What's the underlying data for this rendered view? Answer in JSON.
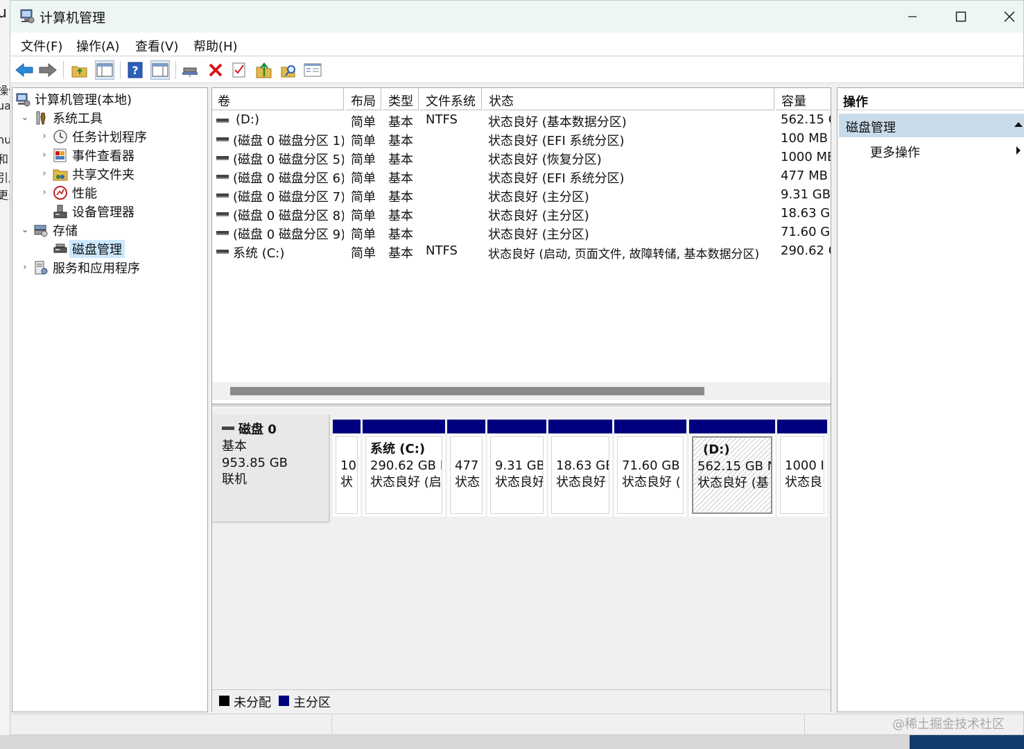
{
  "background": {
    "left_fragments": [
      "u",
      "操作",
      "ua",
      "hu",
      "和",
      "引用",
      "更多"
    ]
  },
  "window": {
    "title": "计算机管理"
  },
  "menubar": {
    "items": [
      "文件(F)",
      "操作(A)",
      "查看(V)",
      "帮助(H)"
    ]
  },
  "toolbar": {
    "icons": [
      "back-arrow-icon",
      "forward-arrow-icon",
      "up-folder-icon",
      "show-hide-console-tree-icon",
      "help-icon",
      "show-hide-action-pane-icon",
      "connect-icon",
      "delete-icon",
      "check-properties-icon",
      "export-icon",
      "search-icon",
      "properties-list-icon"
    ]
  },
  "tree": {
    "root": "计算机管理(本地)",
    "system_tools": "系统工具",
    "task_scheduler": "任务计划程序",
    "event_viewer": "事件查看器",
    "shared_folders": "共享文件夹",
    "performance": "性能",
    "device_manager": "设备管理器",
    "storage": "存储",
    "disk_management": "磁盘管理",
    "services_apps": "服务和应用程序"
  },
  "volume_list": {
    "columns": [
      "卷",
      "布局",
      "类型",
      "文件系统",
      "状态",
      "容量"
    ],
    "rows": [
      {
        "volume": "(D:)",
        "layout": "简单",
        "type": "基本",
        "fs": "NTFS",
        "status": "状态良好 (基本数据分区)",
        "capacity": "562.15 G"
      },
      {
        "volume": "(磁盘 0 磁盘分区 1)",
        "layout": "简单",
        "type": "基本",
        "fs": "",
        "status": "状态良好 (EFI 系统分区)",
        "capacity": "100 MB"
      },
      {
        "volume": "(磁盘 0 磁盘分区 5)",
        "layout": "简单",
        "type": "基本",
        "fs": "",
        "status": "状态良好 (恢复分区)",
        "capacity": "1000 ME"
      },
      {
        "volume": "(磁盘 0 磁盘分区 6)",
        "layout": "简单",
        "type": "基本",
        "fs": "",
        "status": "状态良好 (EFI 系统分区)",
        "capacity": "477 MB"
      },
      {
        "volume": "(磁盘 0 磁盘分区 7)",
        "layout": "简单",
        "type": "基本",
        "fs": "",
        "status": "状态良好 (主分区)",
        "capacity": "9.31 GB"
      },
      {
        "volume": "(磁盘 0 磁盘分区 8)",
        "layout": "简单",
        "type": "基本",
        "fs": "",
        "status": "状态良好 (主分区)",
        "capacity": "18.63 GE"
      },
      {
        "volume": "(磁盘 0 磁盘分区 9)",
        "layout": "简单",
        "type": "基本",
        "fs": "",
        "status": "状态良好 (主分区)",
        "capacity": "71.60 GE"
      },
      {
        "volume": "系统 (C:)",
        "layout": "简单",
        "type": "基本",
        "fs": "NTFS",
        "status": "状态良好 (启动, 页面文件, 故障转储, 基本数据分区)",
        "capacity": "290.62 G"
      }
    ]
  },
  "disk": {
    "name": "磁盘 0",
    "type": "基本",
    "size": "953.85 GB",
    "state": "联机",
    "partitions": [
      {
        "name": "",
        "line1": "10",
        "line2": "状"
      },
      {
        "name": "系统  (C:)",
        "line1": "290.62 GB N",
        "line2": "状态良好 (启"
      },
      {
        "name": "",
        "line1": "477",
        "line2": "状态"
      },
      {
        "name": "",
        "line1": "9.31 GB",
        "line2": "状态良好"
      },
      {
        "name": "",
        "line1": "18.63 GE",
        "line2": "状态良好"
      },
      {
        "name": "",
        "line1": "71.60 GB",
        "line2": "状态良好 ("
      },
      {
        "name": "(D:)",
        "line1": "562.15 GB N",
        "line2": "状态良好 (基"
      },
      {
        "name": "",
        "line1": "1000 I",
        "line2": "状态良"
      }
    ]
  },
  "legend": {
    "unallocated": "未分配",
    "primary": "主分区",
    "unallocated_color": "#000000",
    "primary_color": "#00007e"
  },
  "actions": {
    "title": "操作",
    "group": "磁盘管理",
    "more": "更多操作"
  },
  "watermark": "@稀土掘金技术社区"
}
